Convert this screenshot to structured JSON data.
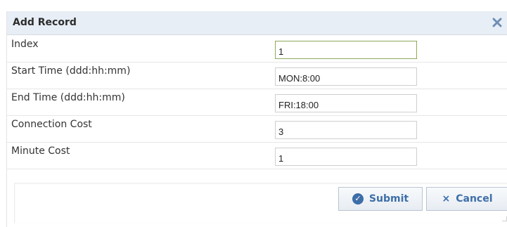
{
  "dialog": {
    "title": "Add Record",
    "close_icon": "close-icon"
  },
  "fields": [
    {
      "label": "Index",
      "value": "1"
    },
    {
      "label": "Start Time (ddd:hh:mm)",
      "value": "MON:8:00"
    },
    {
      "label": "End Time (ddd:hh:mm)",
      "value": "FRI:18:00"
    },
    {
      "label": "Connection Cost",
      "value": "3"
    },
    {
      "label": "Minute Cost",
      "value": "1"
    }
  ],
  "buttons": {
    "submit_label": "Submit",
    "submit_icon": "check-circle-icon",
    "cancel_label": "Cancel",
    "cancel_icon": "x-icon"
  },
  "colors": {
    "header_bg": "#e8eef6",
    "button_text": "#3d6ea8",
    "focused_border": "#8fa85a"
  }
}
